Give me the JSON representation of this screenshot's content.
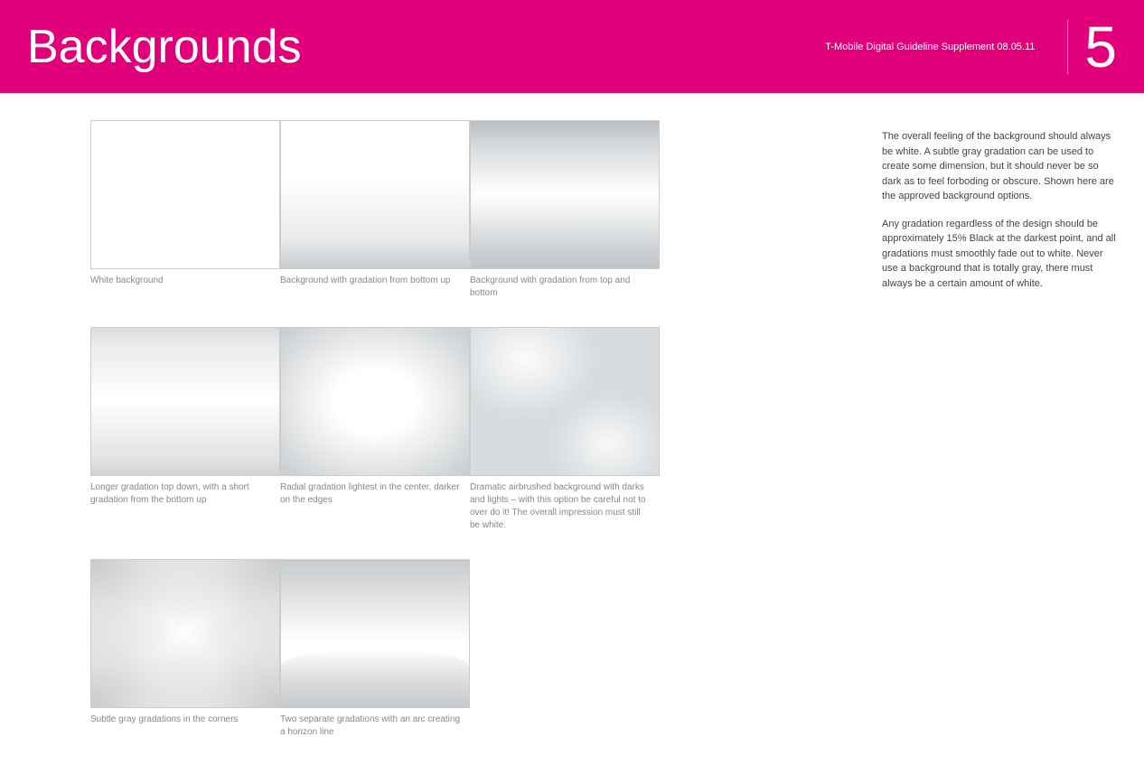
{
  "header": {
    "title": "Backgrounds",
    "subtitle": "T-Mobile Digital Guideline Supplement  08.05.11",
    "page_number": "5"
  },
  "grid": [
    {
      "id": "white",
      "caption": "White background"
    },
    {
      "id": "bottom-up",
      "caption": "Background with gradation from bottom up"
    },
    {
      "id": "top-bottom",
      "caption": "Background with gradation from top and bottom"
    },
    {
      "id": "top-down-short",
      "caption": "Longer gradation top down, with a short gradation from the bottom up"
    },
    {
      "id": "radial",
      "caption": "Radial gradation lightest in the center, darker on the edges"
    },
    {
      "id": "airbrushed",
      "caption": "Dramatic airbrushed background with darks and lights – with this option be careful not to over do it! The overall impression must still be white."
    },
    {
      "id": "corners",
      "caption": "Subtle gray gradations in the corners"
    },
    {
      "id": "horizon",
      "caption": "Two separate gradations with an arc creating a horizon line"
    }
  ],
  "description": {
    "para1": "The overall feeling of the background should always be white. A subtle gray gradation can be used to create some dimension, but it should never be so dark as to feel forboding or obscure. Shown here are the approved background options.",
    "para2": "Any gradation regardless of the design should be approximately 15% Black at the darkest point, and all gradations must smoothly fade out to white. Never use a background that is totally gray, there must always be a certain amount of white."
  }
}
